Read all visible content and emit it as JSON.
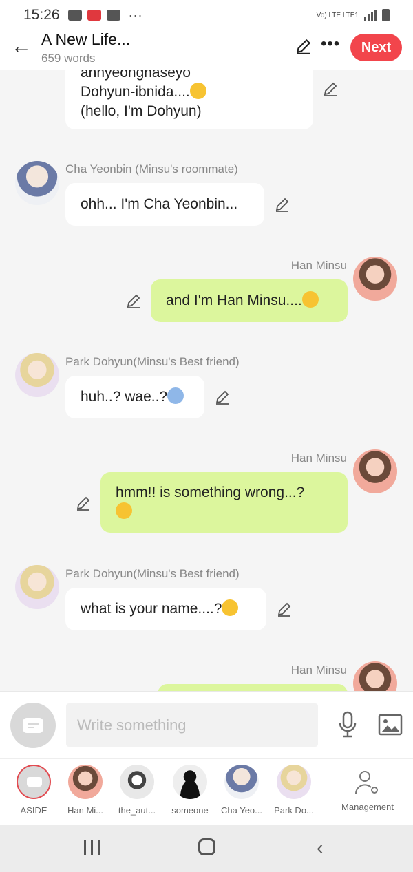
{
  "status_bar": {
    "time": "15:26",
    "network": "Vo) LTE LTE1"
  },
  "header": {
    "title": "A New Life...",
    "word_count": "659 words",
    "next_label": "Next"
  },
  "messages": [
    {
      "side": "left",
      "lines": [
        "annyeonghaseyo",
        "Dohyun-ibnida....",
        "(hello, I'm Dohyun)"
      ],
      "emoji": "grinning-face"
    },
    {
      "side": "left",
      "name": "Cha Yeonbin (Minsu's roommate)",
      "text": "ohh... I'm Cha Yeonbin..."
    },
    {
      "side": "right",
      "name": "Han Minsu",
      "text": "and I'm Han Minsu....",
      "emoji": "smiling-face"
    },
    {
      "side": "left",
      "name": "Park Dohyun(Minsu's Best friend)",
      "text": "huh..? wae..?",
      "emoji": "screaming-face"
    },
    {
      "side": "right",
      "name": "Han Minsu",
      "text": "hmm!! is something wrong...?",
      "emoji": "rolling-eyes-face"
    },
    {
      "side": "left",
      "name": "Park Dohyun(Minsu's Best friend)",
      "text": "what is your name....?",
      "emoji": "exploding-head-face"
    },
    {
      "side": "right",
      "name": "Han Minsu",
      "text": ""
    }
  ],
  "composer": {
    "placeholder": "Write something"
  },
  "roles": [
    {
      "label": "ASIDE"
    },
    {
      "label": "Han Mi..."
    },
    {
      "label": "the_aut..."
    },
    {
      "label": "someone"
    },
    {
      "label": "Cha Yeo..."
    },
    {
      "label": "Park Do..."
    },
    {
      "label": "Management"
    }
  ],
  "colors": {
    "accent": "#f2454c",
    "bubble_self": "#dcf69d",
    "bubble_other": "#ffffff",
    "background": "#f5f5f5"
  }
}
